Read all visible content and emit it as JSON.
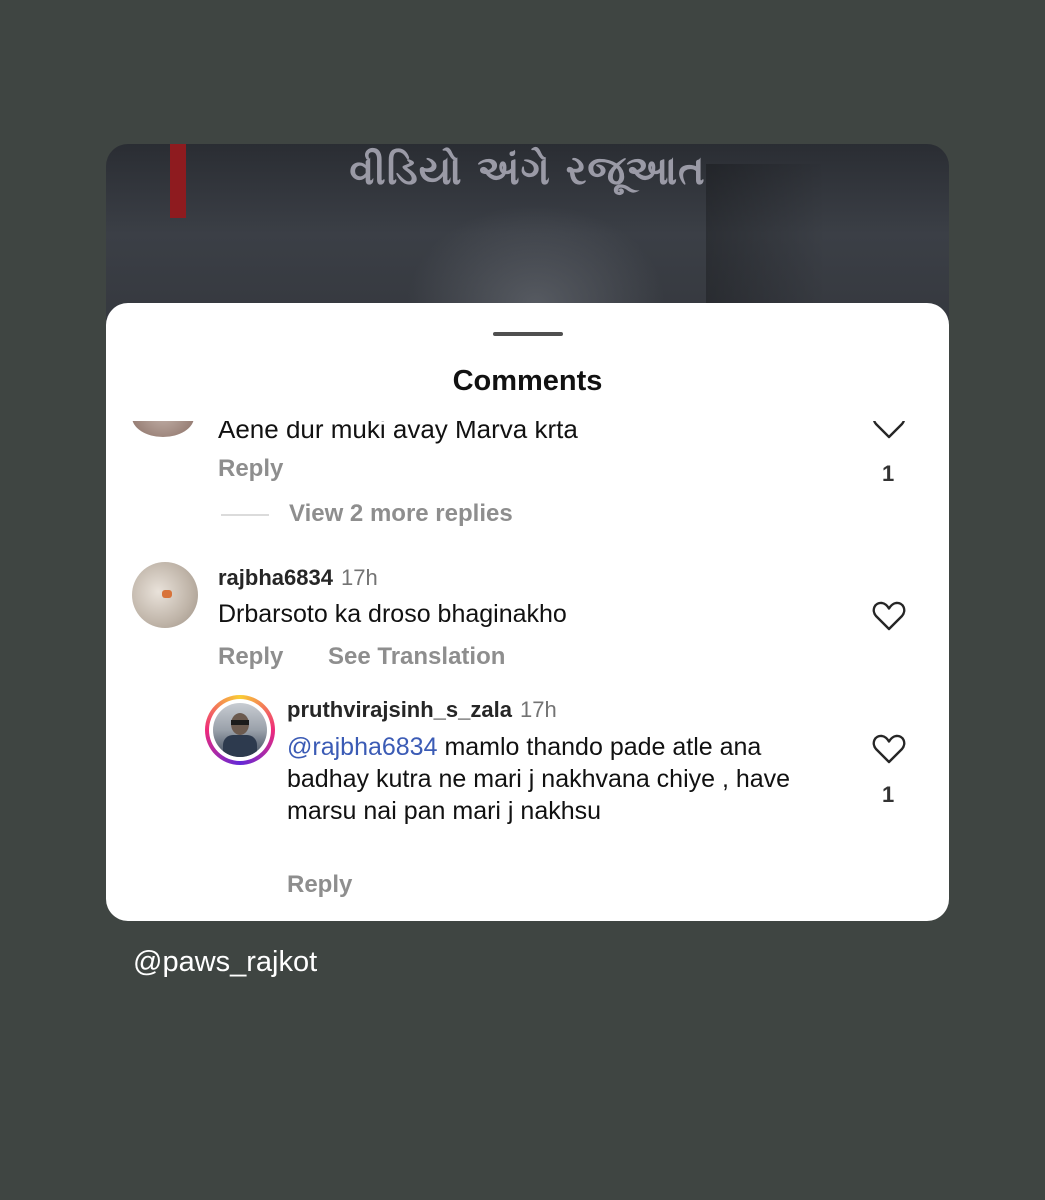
{
  "video": {
    "title": "વીડિયો અંગે રજૂઆત"
  },
  "sheet": {
    "title": "Comments"
  },
  "partial_comment": {
    "text": "Aene dur muki avay Marva krta",
    "reply_label": "Reply",
    "like_count": "1",
    "view_more": "View 2 more replies"
  },
  "comments": [
    {
      "username": "rajbha6834",
      "time": "17h",
      "text": "Drbarsoto ka droso bhaginakho",
      "reply_label": "Reply",
      "translate_label": "See Translation"
    }
  ],
  "reply": {
    "username": "pruthvirajsinh_s_zala",
    "time": "17h",
    "mention": "@rajbha6834",
    "text": " mamlo thando pade atle ana badhay kutra ne mari j nakhvana chiye , have marsu nai pan mari j nakhsu",
    "reply_label": "Reply",
    "like_count": "1"
  },
  "watermark": "@paws_rajkot",
  "icons": [
    "heart-outline-icon"
  ]
}
